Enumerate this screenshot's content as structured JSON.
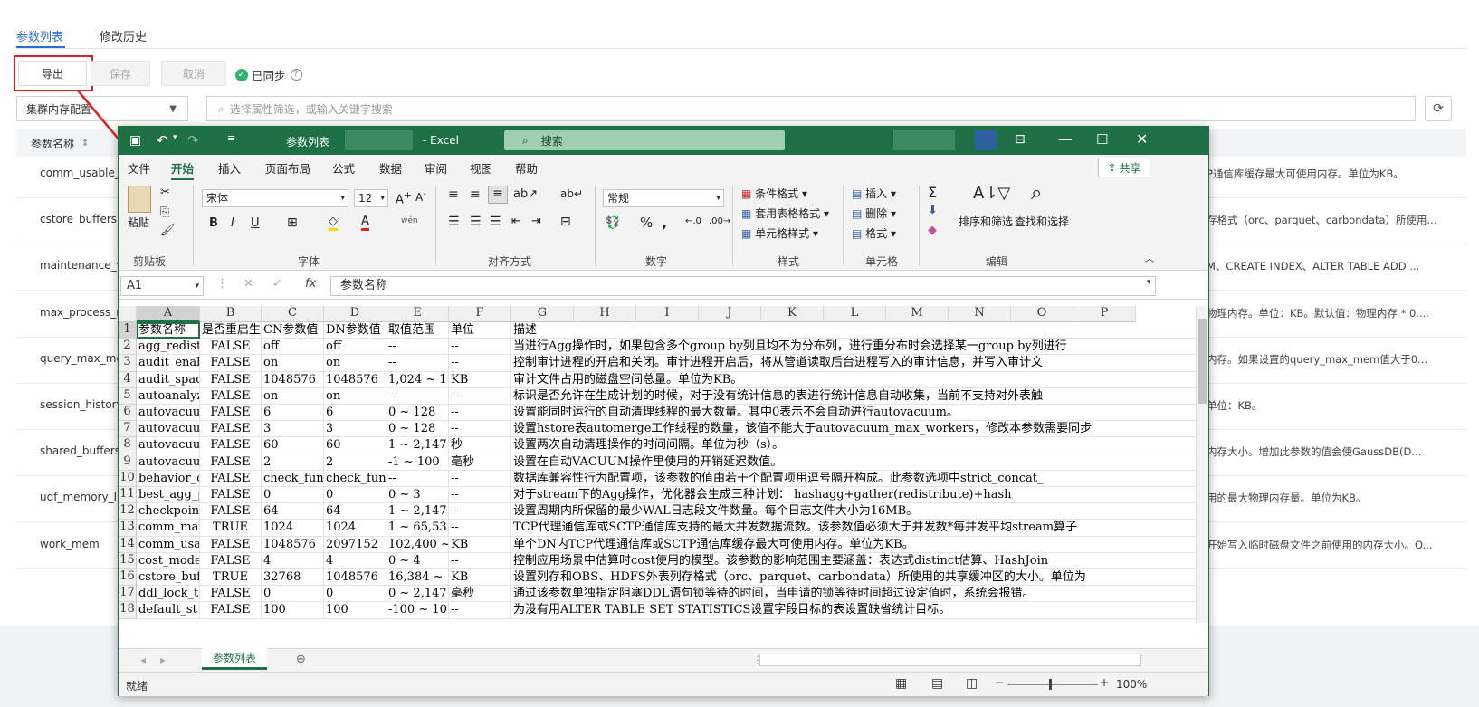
{
  "page": {
    "tabs": [
      "参数列表",
      "修改历史"
    ],
    "toolbar": {
      "export": "导出",
      "save": "保存",
      "cancel": "取消",
      "synced": "已同步"
    },
    "filter_select": "集群内存配置",
    "search_placeholder": "选择属性筛选，或输入关键字搜索",
    "table_header": "参数名称",
    "rows": [
      {
        "name": "comm_usable_m",
        "desc": "P通信库缓存最大可使用内存。单位为KB。"
      },
      {
        "name": "cstore_buffers",
        "desc": "存格式（orc、parquet、carbondata）所使用..."
      },
      {
        "name": "maintenance_w",
        "desc": "M、CREATE INDEX、ALTER TABLE ADD ..."
      },
      {
        "name": "max_process_m",
        "desc": "物理内存。单位：KB。默认值：物理内存 * 0...."
      },
      {
        "name": "query_max_mem",
        "desc": "内存。如果设置的query_max_mem值大于0..."
      },
      {
        "name": "session_history_",
        "desc": "单位：KB。"
      },
      {
        "name": "shared_buffers",
        "desc": "内存大小。增加此参数的值会使GaussDB(D..."
      },
      {
        "name": "udf_memory_lim",
        "desc": "用的最大物理内存量。单位为KB。"
      },
      {
        "name": "work_mem",
        "desc": "开始写入临时磁盘文件之前使用的内存大小。O..."
      }
    ]
  },
  "excel": {
    "title": "参数列表_",
    "app": "- Excel",
    "search": "搜索",
    "share": "共享",
    "menu": [
      "文件",
      "开始",
      "插入",
      "页面布局",
      "公式",
      "数据",
      "审阅",
      "视图",
      "帮助"
    ],
    "active_menu": "开始",
    "ribbon": {
      "paste": "粘贴",
      "clipboard": "剪贴板",
      "font_name": "宋体",
      "font_size": "12",
      "font": "字体",
      "align": "对齐方式",
      "number_format": "常规",
      "number": "数字",
      "cond_format": "条件格式",
      "table_format": "套用表格格式",
      "cell_style": "单元格样式",
      "styles": "样式",
      "insert": "插入",
      "delete": "删除",
      "format": "格式",
      "cells": "单元格",
      "sort_filter": "排序和筛选",
      "find_select": "查找和选择",
      "editing": "编辑"
    },
    "name_box": "A1",
    "formula": "参数名称",
    "columns": [
      "A",
      "B",
      "C",
      "D",
      "E",
      "F",
      "G",
      "H",
      "I",
      "J",
      "K",
      "L",
      "M",
      "N",
      "O",
      "P"
    ],
    "rows": [
      [
        "参数名称",
        "是否重启生",
        "CN参数值",
        "DN参数值",
        "取值范围",
        "单位",
        "描述"
      ],
      [
        "agg_redist",
        "FALSE",
        "off",
        "off",
        "--",
        "--",
        "当进行Agg操作时，如果包含多个group by列且均不为分布列，进行重分布时会选择某一group by列进行"
      ],
      [
        "audit_enab",
        "FALSE",
        "on",
        "on",
        "--",
        "--",
        "控制审计进程的开启和关闭。审计进程开启后，将从管道读取后台进程写入的审计信息，并写入审计文"
      ],
      [
        "audit_spac",
        "FALSE",
        "1048576",
        "1048576",
        "1,024 ~ 1",
        "KB",
        "审计文件占用的磁盘空间总量。单位为KB。"
      ],
      [
        "autoanalyz",
        "FALSE",
        "on",
        "on",
        "--",
        "--",
        "标识是否允许在生成计划的时候，对于没有统计信息的表进行统计信息自动收集，当前不支持对外表触"
      ],
      [
        "autovacuum",
        "FALSE",
        "6",
        "6",
        "0 ~ 128",
        "--",
        "设置能同时运行的自动清理线程的最大数量。其中0表示不会自动进行autovacuum。"
      ],
      [
        "autovacuum",
        "FALSE",
        "3",
        "3",
        "0 ~ 128",
        "--",
        "设置hstore表automerge工作线程的数量，该值不能大于autovacuum_max_workers，修改本参数需要同步"
      ],
      [
        "autovacuum",
        "FALSE",
        "60",
        "60",
        "1 ~ 2,147",
        "秒",
        "设置两次自动清理操作的时间间隔。单位为秒（s）。"
      ],
      [
        "autovacuum",
        "FALSE",
        "2",
        "2",
        "-1 ~ 100",
        "毫秒",
        "设置在自动VACUUM操作里使用的开销延迟数值。"
      ],
      [
        "behavior_c",
        "FALSE",
        "check_func",
        "check_func",
        "--",
        "--",
        "数据库兼容性行为配置项，该参数的值由若干个配置项用逗号隔开构成。此参数选项中strict_concat_"
      ],
      [
        "best_agg_p",
        "FALSE",
        "0",
        "0",
        "0 ~ 3",
        "--",
        "对于stream下的Agg操作，优化器会生成三种计划：       hashagg+gather(redistribute)+hash"
      ],
      [
        "checkpoint",
        "FALSE",
        "64",
        "64",
        "1 ~ 2,147",
        "--",
        "设置周期内所保留的最少WAL日志段文件数量。每个日志文件大小为16MB。"
      ],
      [
        "comm_max_s",
        "TRUE",
        "1024",
        "1024",
        "1 ~ 65,53",
        "--",
        "TCP代理通信库或SCTP通信库支持的最大并发数据流数。该参数值必须大于并发数*每并发平均stream算子"
      ],
      [
        "comm_usabl",
        "FALSE",
        "1048576",
        "2097152",
        "102,400 ~",
        "KB",
        "单个DN内TCP代理通信库或SCTP通信库缓存最大可使用内存。单位为KB。"
      ],
      [
        "cost_model",
        "FALSE",
        "4",
        "4",
        "0 ~ 4",
        "--",
        "控制应用场景中估算时cost使用的模型。该参数的影响范围主要涵盖：表达式distinct估算、HashJoin"
      ],
      [
        "cstore_buf",
        "TRUE",
        "32768",
        "1048576",
        "16,384 ~",
        "KB",
        "设置列存和OBS、HDFS外表列存格式（orc、parquet、carbondata）所使用的共享缓冲区的大小。单位为"
      ],
      [
        "ddl_lock_t",
        "FALSE",
        "0",
        "0",
        "0 ~ 2,147",
        "毫秒",
        "通过该参数单独指定阻塞DDL语句锁等待的时间，当申请的锁等待时间超过设定值时，系统会报错。"
      ],
      [
        "default_st",
        "FALSE",
        "100",
        "100",
        "-100 ~ 10",
        "--",
        "为没有用ALTER TABLE SET STATISTICS设置字段目标的表设置缺省统计目标。"
      ]
    ],
    "sheet_tab": "参数列表",
    "status": "就绪",
    "zoom": "100%"
  }
}
